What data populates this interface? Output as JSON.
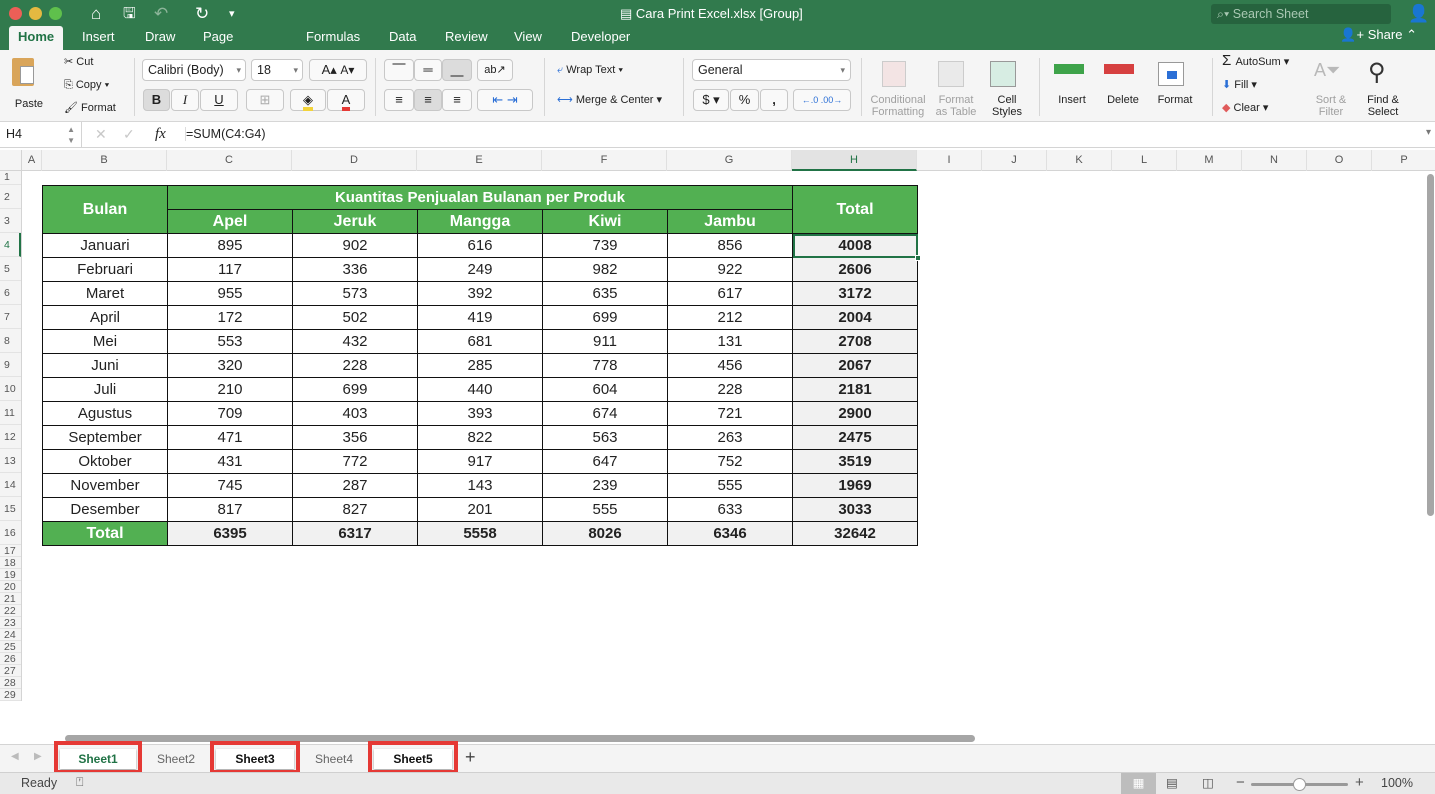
{
  "window": {
    "title": "Cara Print Excel.xlsx  [Group]",
    "search_placeholder": "Search Sheet",
    "share_label": "Share"
  },
  "ribbon_tabs": [
    "Home",
    "Insert",
    "Draw",
    "Page Layout",
    "Formulas",
    "Data",
    "Review",
    "View",
    "Developer"
  ],
  "active_tab": "Home",
  "ribbon": {
    "paste": "Paste",
    "cut": "Cut",
    "copy": "Copy",
    "format_painter": "Format",
    "font_name": "Calibri (Body)",
    "font_size": "18",
    "bold": "B",
    "italic": "I",
    "underline": "U",
    "wrap_text": "Wrap Text",
    "merge_center": "Merge & Center",
    "number_format": "General",
    "currency": "$",
    "percent": "%",
    "comma": ",",
    "conditional_formatting": [
      "Conditional",
      "Formatting"
    ],
    "format_as_table": [
      "Format",
      "as Table"
    ],
    "cell_styles": [
      "Cell",
      "Styles"
    ],
    "insert": "Insert",
    "delete": "Delete",
    "format": "Format",
    "autosum": "AutoSum",
    "fill": "Fill",
    "clear": "Clear",
    "sort_filter": [
      "Sort &",
      "Filter"
    ],
    "find_select": [
      "Find &",
      "Select"
    ]
  },
  "formula_bar": {
    "name_box": "H4",
    "fx": "fx",
    "formula": "=SUM(C4:G4)"
  },
  "columns": [
    "A",
    "B",
    "C",
    "D",
    "E",
    "F",
    "G",
    "H",
    "I",
    "J",
    "K",
    "L",
    "M",
    "N",
    "O",
    "P"
  ],
  "selected_column": "H",
  "rows": [
    "1",
    "2",
    "3",
    "4",
    "5",
    "6",
    "7",
    "8",
    "9",
    "10",
    "11",
    "12",
    "13",
    "14",
    "15",
    "16",
    "17",
    "18",
    "19",
    "20",
    "21",
    "22",
    "23",
    "24",
    "25",
    "26",
    "27",
    "28",
    "29"
  ],
  "selected_row": "4",
  "table": {
    "header_month": "Bulan",
    "header_group": "Kuantitas Penjualan Bulanan per Produk",
    "header_total": "Total",
    "products": [
      "Apel",
      "Jeruk",
      "Mangga",
      "Kiwi",
      "Jambu"
    ],
    "rows": [
      {
        "month": "Januari",
        "values": [
          "895",
          "902",
          "616",
          "739",
          "856"
        ],
        "total": "4008"
      },
      {
        "month": "Februari",
        "values": [
          "117",
          "336",
          "249",
          "982",
          "922"
        ],
        "total": "2606"
      },
      {
        "month": "Maret",
        "values": [
          "955",
          "573",
          "392",
          "635",
          "617"
        ],
        "total": "3172"
      },
      {
        "month": "April",
        "values": [
          "172",
          "502",
          "419",
          "699",
          "212"
        ],
        "total": "2004"
      },
      {
        "month": "Mei",
        "values": [
          "553",
          "432",
          "681",
          "911",
          "131"
        ],
        "total": "2708"
      },
      {
        "month": "Juni",
        "values": [
          "320",
          "228",
          "285",
          "778",
          "456"
        ],
        "total": "2067"
      },
      {
        "month": "Juli",
        "values": [
          "210",
          "699",
          "440",
          "604",
          "228"
        ],
        "total": "2181"
      },
      {
        "month": "Agustus",
        "values": [
          "709",
          "403",
          "393",
          "674",
          "721"
        ],
        "total": "2900"
      },
      {
        "month": "September",
        "values": [
          "471",
          "356",
          "822",
          "563",
          "263"
        ],
        "total": "2475"
      },
      {
        "month": "Oktober",
        "values": [
          "431",
          "772",
          "917",
          "647",
          "752"
        ],
        "total": "3519"
      },
      {
        "month": "November",
        "values": [
          "745",
          "287",
          "143",
          "239",
          "555"
        ],
        "total": "1969"
      },
      {
        "month": "Desember",
        "values": [
          "817",
          "827",
          "201",
          "555",
          "633"
        ],
        "total": "3033"
      }
    ],
    "footer": {
      "label": "Total",
      "values": [
        "6395",
        "6317",
        "5558",
        "8026",
        "6346"
      ],
      "total": "32642"
    }
  },
  "sheets": [
    {
      "name": "Sheet1",
      "selected": true,
      "active": true,
      "highlighted": true
    },
    {
      "name": "Sheet2",
      "selected": false,
      "active": false,
      "highlighted": false
    },
    {
      "name": "Sheet3",
      "selected": true,
      "active": false,
      "highlighted": true
    },
    {
      "name": "Sheet4",
      "selected": false,
      "active": false,
      "highlighted": false
    },
    {
      "name": "Sheet5",
      "selected": true,
      "active": false,
      "highlighted": true
    }
  ],
  "status": {
    "ready": "Ready",
    "zoom": "100%",
    "zoom_level_percent": 100
  },
  "colors": {
    "brand": "#217346",
    "titlebar": "#317a4d",
    "table_header": "#52b052",
    "highlight_box": "#e53935"
  }
}
